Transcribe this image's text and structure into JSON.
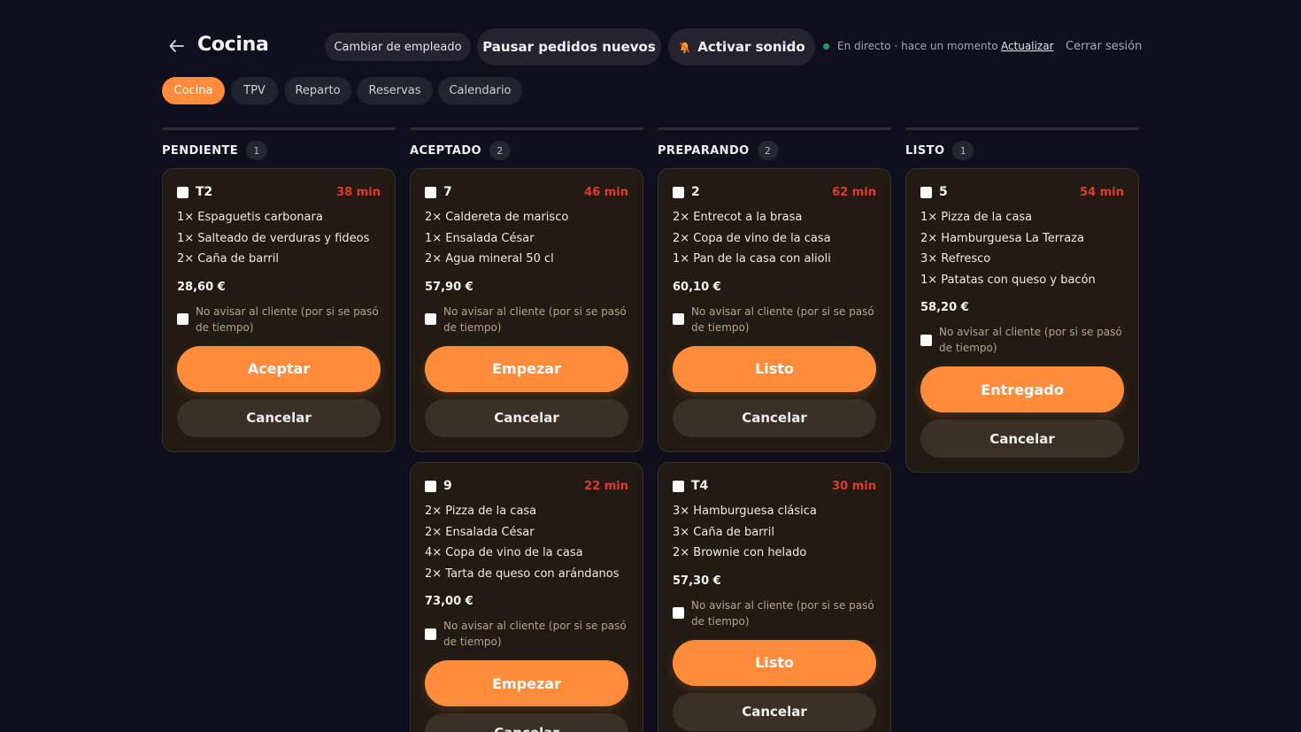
{
  "header": {
    "title": "Cocina",
    "switch_employee": "Cambiar de empleado",
    "pause_orders": "Pausar pedidos nuevos",
    "activate_sound": "Activar sonido",
    "status_text": "En directo · hace un momento",
    "refresh": "Actualizar",
    "logout": "Cerrar sesión"
  },
  "tabs": [
    {
      "label": "Cocina",
      "active": true
    },
    {
      "label": "TPV",
      "active": false
    },
    {
      "label": "Reparto",
      "active": false
    },
    {
      "label": "Reservas",
      "active": false
    },
    {
      "label": "Calendario",
      "active": false
    }
  ],
  "colors": {
    "accent": "#ff8c3b",
    "elapsed": "#df3a2a",
    "live": "#1f9d6a"
  },
  "notify_label": "No avisar al cliente (por si se pasó de tiempo)",
  "cancel_label": "Cancelar",
  "columns": [
    {
      "title": "PENDIENTE",
      "count": "1",
      "orders": [
        {
          "id": "T2",
          "elapsed": "38 min",
          "items": [
            "1× Espaguetis carbonara",
            "1× Salteado de verduras y fideos",
            "2× Caña de barril"
          ],
          "total": "28,60 €",
          "action": "Aceptar"
        }
      ]
    },
    {
      "title": "ACEPTADO",
      "count": "2",
      "orders": [
        {
          "id": "7",
          "elapsed": "46 min",
          "items": [
            "2× Caldereta de marisco",
            "1× Ensalada César",
            "2× Agua mineral 50 cl"
          ],
          "total": "57,90 €",
          "action": "Empezar"
        },
        {
          "id": "9",
          "elapsed": "22 min",
          "items": [
            "2× Pizza de la casa",
            "2× Ensalada César",
            "4× Copa de vino de la casa",
            "2× Tarta de queso con arándanos"
          ],
          "total": "73,00 €",
          "action": "Empezar"
        }
      ]
    },
    {
      "title": "PREPARANDO",
      "count": "2",
      "orders": [
        {
          "id": "2",
          "elapsed": "62 min",
          "items": [
            "2× Entrecot a la brasa",
            "2× Copa de vino de la casa",
            "1× Pan de la casa con alioli"
          ],
          "total": "60,10 €",
          "action": "Listo"
        },
        {
          "id": "T4",
          "elapsed": "30 min",
          "items": [
            "3× Hamburguesa clásica",
            "3× Caña de barril",
            "2× Brownie con helado"
          ],
          "total": "57,30 €",
          "action": "Listo"
        }
      ]
    },
    {
      "title": "LISTO",
      "count": "1",
      "orders": [
        {
          "id": "5",
          "elapsed": "54 min",
          "items": [
            "1× Pizza de la casa",
            "2× Hamburguesa La Terraza",
            "3× Refresco",
            "1× Patatas con queso y bacón"
          ],
          "total": "58,20 €",
          "action": "Entregado"
        }
      ]
    }
  ]
}
